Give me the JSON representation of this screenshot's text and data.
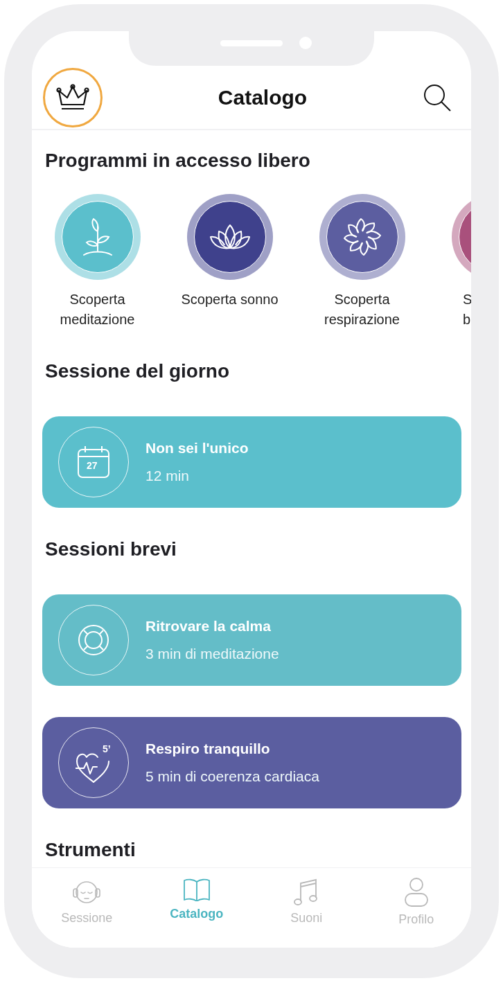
{
  "header": {
    "title": "Catalogo"
  },
  "sections": [
    {
      "title": "Programmi in accesso libero",
      "kind": "programs",
      "programs": [
        {
          "lines": [
            "Scoperta",
            "meditazione"
          ],
          "kind": "plant",
          "color": "#5bbfcc"
        },
        {
          "lines": [
            "Scoperta sonno"
          ],
          "kind": "lotus",
          "color": "#3f418c"
        },
        {
          "lines": [
            "Scoperta",
            "respirazione"
          ],
          "kind": "swirl",
          "color": "#5c5ea0"
        },
        {
          "lines": [
            "S",
            "b"
          ],
          "kind": "cut",
          "color": "#a9507c"
        }
      ]
    },
    {
      "title": "Sessione del giorno",
      "kind": "cards",
      "cards": [
        {
          "title": "Non sei l'unico",
          "subtitle": "12 min",
          "kind": "calendar",
          "icon_text": "27",
          "color": "#5bbfcc"
        }
      ]
    },
    {
      "title": "Sessioni brevi",
      "kind": "cards",
      "cards": [
        {
          "title": "Ritrovare la calma",
          "subtitle": "3 min di meditazione",
          "kind": "lifebuoy",
          "color": "#64bdc8"
        },
        {
          "title": "Respiro tranquillo",
          "subtitle": "5 min di coerenza cardiaca",
          "kind": "heart",
          "icon_text": "5’",
          "color": "#5b5ea0"
        }
      ]
    },
    {
      "title": "Strumenti",
      "kind": "cards"
    }
  ],
  "tabs": [
    {
      "label": "Sessione",
      "kind": "headphones",
      "selected": false
    },
    {
      "label": "Catalogo",
      "kind": "book",
      "selected": true
    },
    {
      "label": "Suoni",
      "kind": "music",
      "selected": false
    },
    {
      "label": "Profilo",
      "kind": "person",
      "selected": false
    }
  ]
}
